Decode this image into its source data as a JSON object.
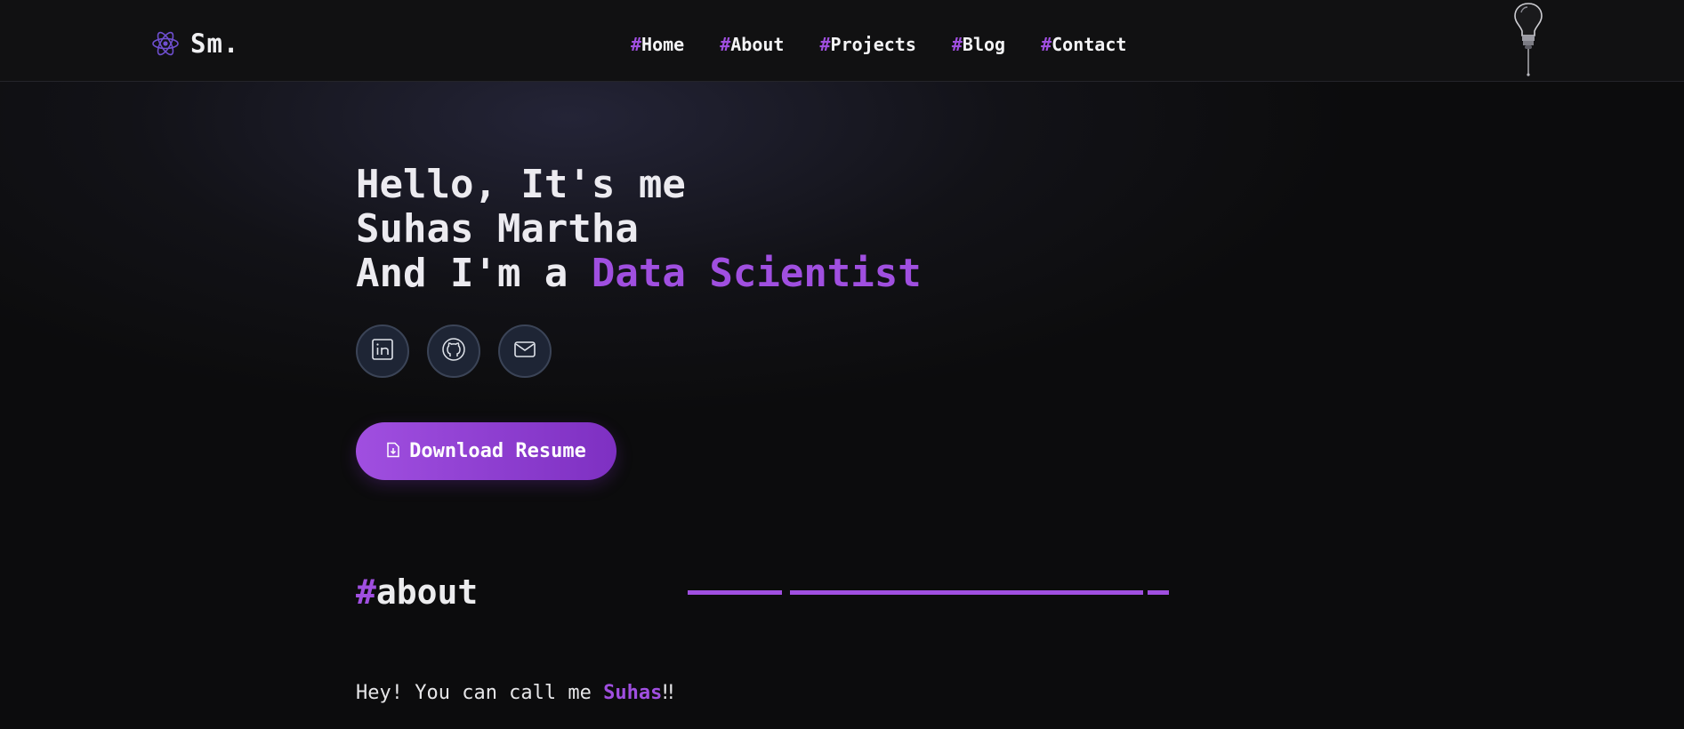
{
  "header": {
    "logo_text": "Sm.",
    "logo_icon": "atom-icon",
    "nav": [
      {
        "hash": "#",
        "label": "Home"
      },
      {
        "hash": "#",
        "label": "About"
      },
      {
        "hash": "#",
        "label": "Projects"
      },
      {
        "hash": "#",
        "label": "Blog"
      },
      {
        "hash": "#",
        "label": "Contact"
      }
    ],
    "theme_toggle_icon": "lightbulb-icon"
  },
  "hero": {
    "line1": "Hello, It's me",
    "line2": "Suhas Martha",
    "line3_prefix": "And I'm a ",
    "line3_role": "Data Scientist",
    "socials": [
      {
        "icon": "linkedin-icon"
      },
      {
        "icon": "github-icon"
      },
      {
        "icon": "mail-icon"
      }
    ],
    "resume_button": {
      "label": "Download Resume",
      "icon": "file-download-icon"
    }
  },
  "about": {
    "heading_hash": "#",
    "heading": "about",
    "intro_prefix": "Hey! You can call me ",
    "intro_name": "Suhas",
    "intro_suffix": "‼"
  },
  "colors": {
    "accent": "#a04fe0",
    "background": "#0c0c0d",
    "header_bg": "#111112",
    "social_bg": "#1e2535"
  }
}
